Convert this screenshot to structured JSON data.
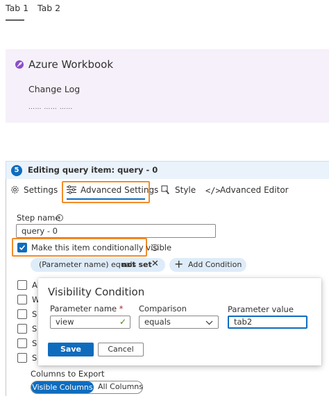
{
  "tabs": [
    {
      "label": "Tab 1",
      "selected": true
    },
    {
      "label": "Tab 2",
      "selected": false
    }
  ],
  "workbook": {
    "icon": "rocket-icon",
    "title": "Azure Workbook",
    "subtitle": "Change Log",
    "placeholder_text": "…… …… ……"
  },
  "editor": {
    "step_number": "5",
    "title": "Editing query item: query - 0",
    "subtabs": [
      {
        "label": "Settings",
        "icon": "gear-icon"
      },
      {
        "label": "Advanced Settings",
        "icon": "sliders-icon",
        "selected": true
      },
      {
        "label": "Style",
        "icon": "brush-icon"
      },
      {
        "label": "Advanced Editor",
        "icon": "code-icon"
      }
    ],
    "step_name_label": "Step name",
    "step_name_value": "query - 0",
    "conditional_label": "Make this item conditionally visible",
    "conditional_checked": true,
    "condition_pill_text": "(Parameter name) equals",
    "condition_pill_bold": "not set",
    "add_condition_label": "Add Condition",
    "hidden_rows": [
      "A",
      "W",
      "S",
      "S",
      "S",
      "S"
    ],
    "columns_to_export_label": "Columns to Export",
    "columns_options": [
      "Visible Columns",
      "All Columns"
    ],
    "columns_selected": "Visible Columns"
  },
  "dialog": {
    "title": "Visibility Condition",
    "param_name_label": "Parameter name",
    "required_marker": "*",
    "param_name_value": "view",
    "comparison_label": "Comparison",
    "comparison_value": "equals",
    "param_value_label": "Parameter value",
    "param_value_value": "tab2",
    "save_label": "Save",
    "cancel_label": "Cancel"
  },
  "colors": {
    "accent": "#0f6cbd",
    "highlight": "#f28c28",
    "workbook_bg": "#f6f0fa",
    "pill_bg": "#deecf9"
  }
}
